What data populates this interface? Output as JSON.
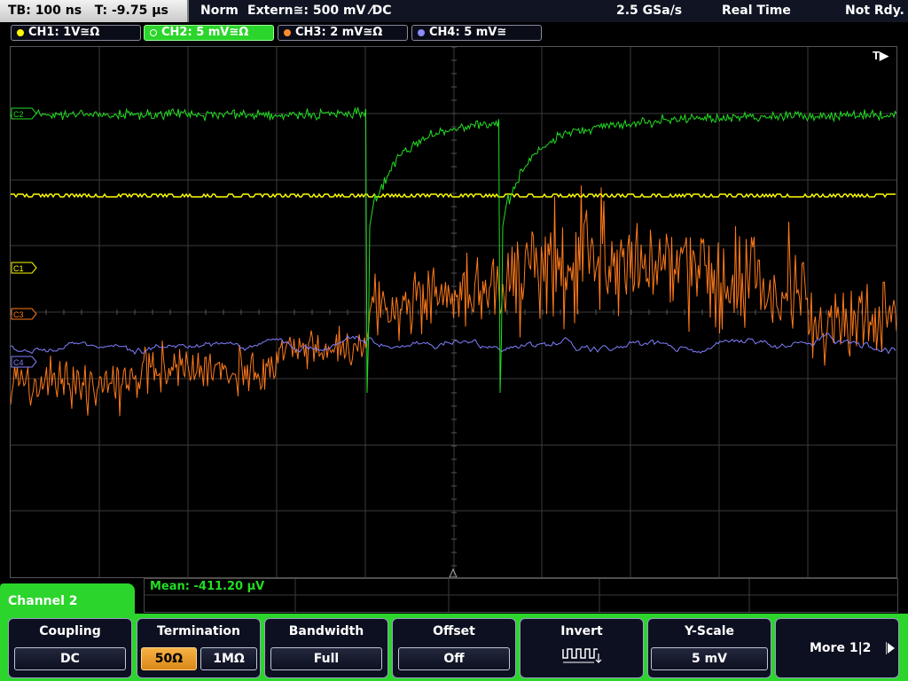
{
  "status": {
    "timebase": "TB: 100 ns",
    "trigger_time": "T: -9.75 µs",
    "mode": "Norm",
    "trigger_source": "Extern≅: 500 mV ⁄DC",
    "sample_rate": "2.5 GSa/s",
    "acq_mode": "Real Time",
    "state": "Not Rdy."
  },
  "channels": [
    {
      "label": "CH1: 1V≅Ω",
      "color": "#ffff00",
      "active": false
    },
    {
      "label": "CH2: 5 mV≅Ω",
      "color": "#22cc22",
      "active": true
    },
    {
      "label": "CH3: 2 mV≅Ω",
      "color": "#ff8a2a",
      "active": false
    },
    {
      "label": "CH4: 5 mV≅",
      "color": "#8c8cff",
      "active": false
    }
  ],
  "screen": {
    "trigger_marker": "T▶",
    "markers": [
      "C1",
      "C3",
      "C4",
      "C2"
    ]
  },
  "measurement": {
    "text": "Mean: -411.20 µV"
  },
  "menu": {
    "title": "Channel 2",
    "softkeys": {
      "coupling": {
        "title": "Coupling",
        "value": "DC"
      },
      "termination": {
        "title": "Termination",
        "options": [
          "50Ω",
          "1MΩ"
        ],
        "selected": "50Ω"
      },
      "bandwidth": {
        "title": "Bandwidth",
        "value": "Full"
      },
      "offset": {
        "title": "Offset",
        "value": "Off"
      },
      "invert": {
        "title": "Invert",
        "icon": "square-wave-invert-icon"
      },
      "yscale": {
        "title": "Y-Scale",
        "value": "5 mV"
      },
      "more": {
        "label": "More 1|2",
        "icon": "arrow-right-icon"
      }
    }
  }
}
